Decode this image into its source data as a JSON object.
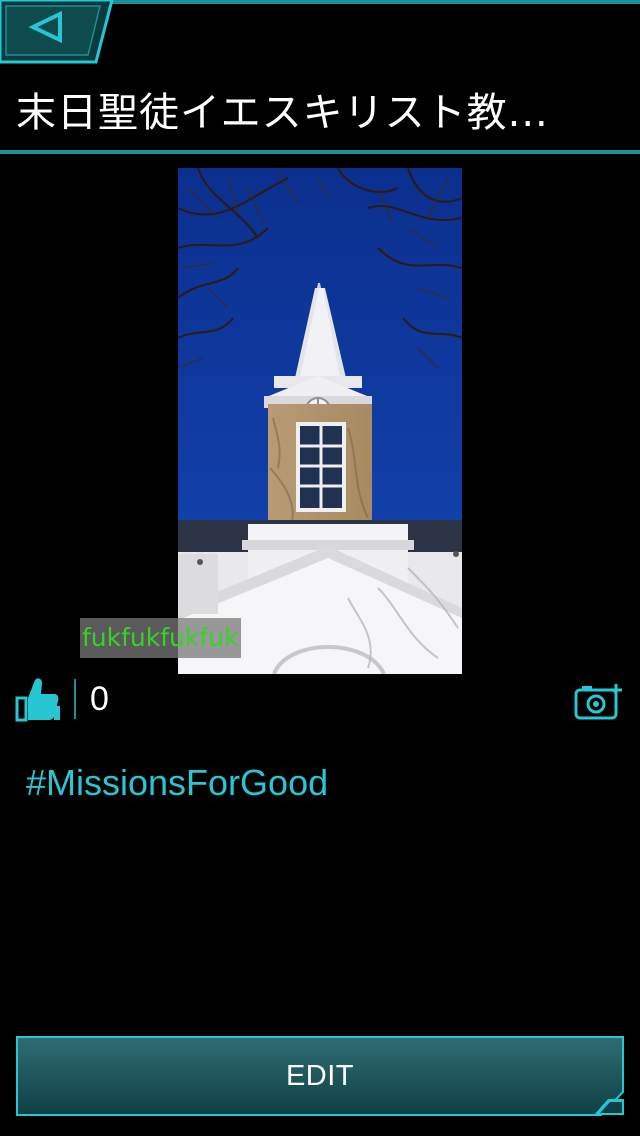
{
  "header": {
    "back_icon": "back-triangle-icon",
    "title": "末日聖徒イエスキリスト教..."
  },
  "photo": {
    "subject": "church-steeple-photo",
    "owner_tag": "fukfukfukfuk"
  },
  "likes": {
    "icon": "thumbs-up-icon",
    "count": "0"
  },
  "camera": {
    "icon": "add-photo-camera-icon"
  },
  "description": "#MissionsForGood",
  "edit_button": {
    "label": "EDIT"
  },
  "colors": {
    "accent": "#27c6d3",
    "accent_dark": "#1b8f93",
    "owner_tag_text": "#38d12a",
    "background": "#000000"
  }
}
